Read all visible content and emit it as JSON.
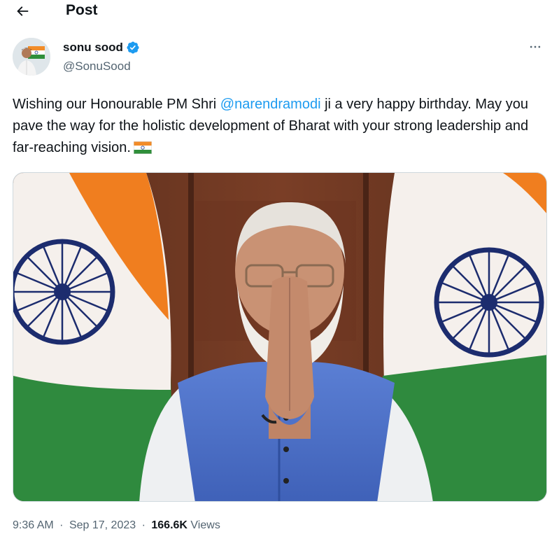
{
  "header": {
    "title": "Post",
    "back_icon": "arrow-left-icon"
  },
  "author": {
    "display_name": "sonu sood",
    "handle": "@SonuSood",
    "verified_icon": "verified-badge-icon",
    "verified_color": "#1d9bf0",
    "more_icon": "more-horizontal-icon"
  },
  "tweet": {
    "text_before": "Wishing our Honourable PM Shri ",
    "mention": "@narendramodi",
    "text_after": " ji a very happy birthday. May you pave the way for the holistic development of Bharat with your strong leadership and far-reaching vision.",
    "emoji": "flag-india-icon"
  },
  "meta": {
    "time": "9:36 AM",
    "dot1": "·",
    "date": "Sep 17, 2023",
    "dot2": "·",
    "views_count": "166.6K",
    "views_label": "Views"
  },
  "colors": {
    "text": "#0f1419",
    "secondary": "#536471",
    "accent": "#1d9bf0"
  }
}
